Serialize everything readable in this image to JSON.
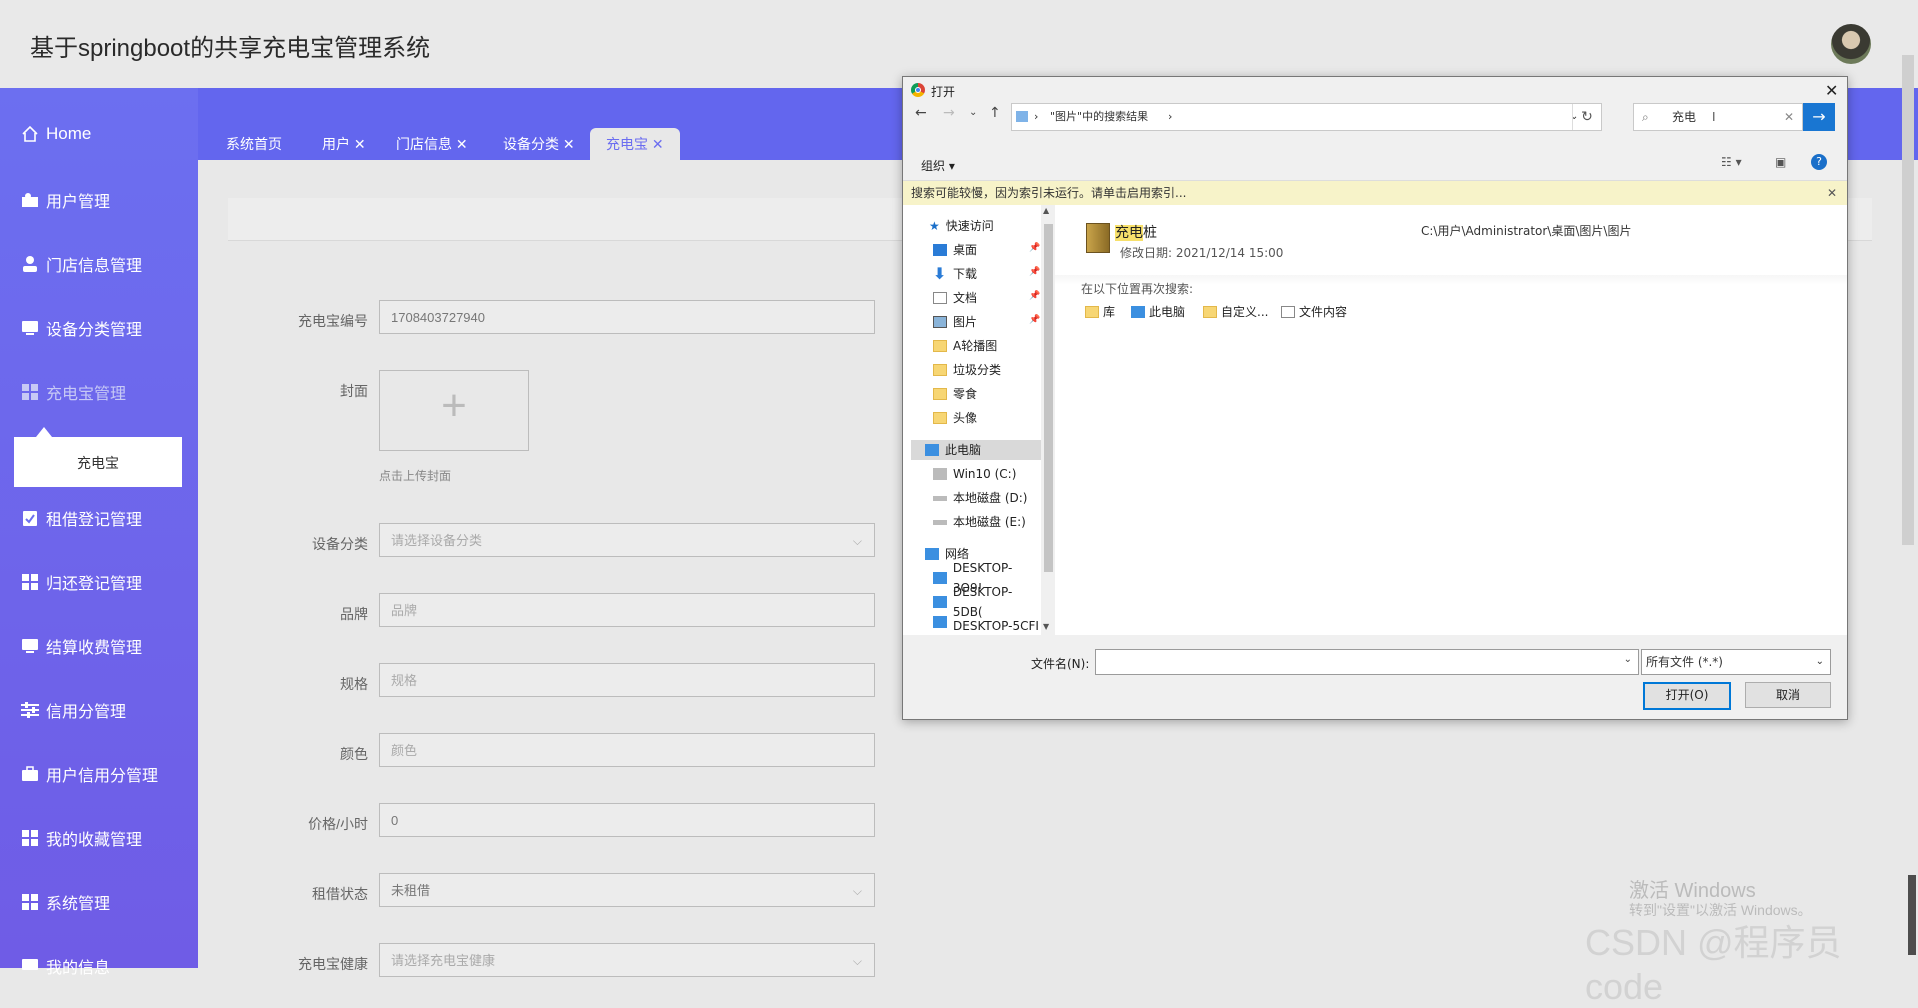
{
  "header": {
    "title": "基于springboot的共享充电宝管理系统"
  },
  "sidebar": {
    "items": [
      {
        "label": "Home",
        "icon": "home-icon"
      },
      {
        "label": "用户管理",
        "icon": "user-icon"
      },
      {
        "label": "门店信息管理",
        "icon": "person-icon"
      },
      {
        "label": "设备分类管理",
        "icon": "monitor-icon"
      },
      {
        "label": "充电宝管理",
        "icon": "grid-icon"
      },
      {
        "label": "租借登记管理",
        "icon": "clipboard-icon"
      },
      {
        "label": "归还登记管理",
        "icon": "grid-icon"
      },
      {
        "label": "结算收费管理",
        "icon": "monitor-icon"
      },
      {
        "label": "信用分管理",
        "icon": "sliders-icon"
      },
      {
        "label": "用户信用分管理",
        "icon": "briefcase-icon"
      },
      {
        "label": "我的收藏管理",
        "icon": "grid-icon"
      },
      {
        "label": "系统管理",
        "icon": "grid-icon"
      },
      {
        "label": "我的信息",
        "icon": "monitor-icon"
      }
    ],
    "submenu": {
      "label": "充电宝"
    }
  },
  "tabs": [
    {
      "label": "系统首页"
    },
    {
      "label": "用户 ✕"
    },
    {
      "label": "门店信息 ✕"
    },
    {
      "label": "设备分类 ✕"
    },
    {
      "label": "充电宝 ✕"
    }
  ],
  "form": {
    "code_label": "充电宝编号",
    "code_value": "1708403727940",
    "cover_label": "封面",
    "cover_hint": "点击上传封面",
    "category_label": "设备分类",
    "category_placeholder": "请选择设备分类",
    "brand_label": "品牌",
    "brand_placeholder": "品牌",
    "spec_label": "规格",
    "spec_placeholder": "规格",
    "color_label": "颜色",
    "color_placeholder": "颜色",
    "price_label": "价格/小时",
    "price_value": "0",
    "status_label": "租借状态",
    "status_value": "未租借",
    "health_label": "充电宝健康",
    "health_placeholder": "请选择充电宝健康"
  },
  "watermark": {
    "line1": "激活 Windows",
    "line2": "转到\"设置\"以激活 Windows。",
    "csdn": "CSDN @程序员code"
  },
  "dialog": {
    "title": "打开",
    "address": "\"图片\"中的搜索结果",
    "search_value": "充电",
    "organize": "组织 ▾",
    "info_bar": "搜索可能较慢，因为索引未运行。请单击启用索引...",
    "tree": [
      {
        "label": "快速访问"
      },
      {
        "label": "桌面"
      },
      {
        "label": "下载"
      },
      {
        "label": "文档"
      },
      {
        "label": "图片"
      },
      {
        "label": "A轮播图"
      },
      {
        "label": "垃圾分类"
      },
      {
        "label": "零食"
      },
      {
        "label": "头像"
      },
      {
        "label": "此电脑"
      },
      {
        "label": "Win10 (C:)"
      },
      {
        "label": "本地磁盘 (D:)"
      },
      {
        "label": "本地磁盘 (E:)"
      },
      {
        "label": "网络"
      },
      {
        "label": "DESKTOP-3O9!"
      },
      {
        "label": "DESKTOP-5DB("
      },
      {
        "label": "DESKTOP-5CFI"
      }
    ],
    "result": {
      "name_highlight": "充电",
      "name_rest": "桩",
      "date": "修改日期: 2021/12/14 15:00",
      "path": "C:\\用户\\Administrator\\桌面\\图片\\图片"
    },
    "search_again_label": "在以下位置再次搜索:",
    "search_again": [
      {
        "label": "库"
      },
      {
        "label": "此电脑"
      },
      {
        "label": "自定义..."
      },
      {
        "label": "文件内容"
      }
    ],
    "filename_label": "文件名(N):",
    "filetype": "所有文件 (*.*)",
    "open_button": "打开(O)",
    "cancel_button": "取消"
  }
}
